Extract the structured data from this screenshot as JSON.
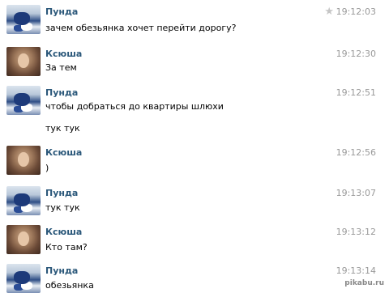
{
  "messages": [
    {
      "author": "Пунда",
      "time": "19:12:03",
      "lines": [
        "зачем обезьянка хочет перейти дорогу?"
      ],
      "starred": true
    },
    {
      "author": "Ксюша",
      "time": "19:12:30",
      "lines": [
        "За тем"
      ]
    },
    {
      "author": "Пунда",
      "time": "19:12:51",
      "lines": [
        "чтобы добраться до квартиры шлюхи",
        "тук тук"
      ]
    },
    {
      "author": "Ксюша",
      "time": "19:12:56",
      "lines": [
        ")"
      ]
    },
    {
      "author": "Пунда",
      "time": "19:13:07",
      "lines": [
        "тук тук"
      ]
    },
    {
      "author": "Ксюша",
      "time": "19:13:12",
      "lines": [
        "Кто там?"
      ]
    },
    {
      "author": "Пунда",
      "time": "19:13:14",
      "lines": [
        "обезьянка"
      ]
    }
  ],
  "icons": {
    "star": "star-icon"
  },
  "watermark": "pikabu.ru"
}
